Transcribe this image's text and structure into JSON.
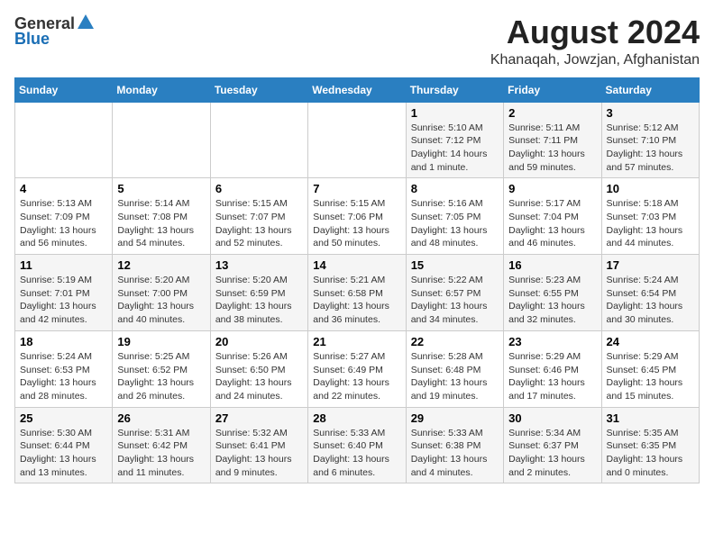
{
  "header": {
    "logo_general": "General",
    "logo_blue": "Blue",
    "title": "August 2024",
    "subtitle": "Khanaqah, Jowzjan, Afghanistan"
  },
  "columns": [
    "Sunday",
    "Monday",
    "Tuesday",
    "Wednesday",
    "Thursday",
    "Friday",
    "Saturday"
  ],
  "weeks": [
    [
      {
        "day": "",
        "info": ""
      },
      {
        "day": "",
        "info": ""
      },
      {
        "day": "",
        "info": ""
      },
      {
        "day": "",
        "info": ""
      },
      {
        "day": "1",
        "info": "Sunrise: 5:10 AM\nSunset: 7:12 PM\nDaylight: 14 hours\nand 1 minute."
      },
      {
        "day": "2",
        "info": "Sunrise: 5:11 AM\nSunset: 7:11 PM\nDaylight: 13 hours\nand 59 minutes."
      },
      {
        "day": "3",
        "info": "Sunrise: 5:12 AM\nSunset: 7:10 PM\nDaylight: 13 hours\nand 57 minutes."
      }
    ],
    [
      {
        "day": "4",
        "info": "Sunrise: 5:13 AM\nSunset: 7:09 PM\nDaylight: 13 hours\nand 56 minutes."
      },
      {
        "day": "5",
        "info": "Sunrise: 5:14 AM\nSunset: 7:08 PM\nDaylight: 13 hours\nand 54 minutes."
      },
      {
        "day": "6",
        "info": "Sunrise: 5:15 AM\nSunset: 7:07 PM\nDaylight: 13 hours\nand 52 minutes."
      },
      {
        "day": "7",
        "info": "Sunrise: 5:15 AM\nSunset: 7:06 PM\nDaylight: 13 hours\nand 50 minutes."
      },
      {
        "day": "8",
        "info": "Sunrise: 5:16 AM\nSunset: 7:05 PM\nDaylight: 13 hours\nand 48 minutes."
      },
      {
        "day": "9",
        "info": "Sunrise: 5:17 AM\nSunset: 7:04 PM\nDaylight: 13 hours\nand 46 minutes."
      },
      {
        "day": "10",
        "info": "Sunrise: 5:18 AM\nSunset: 7:03 PM\nDaylight: 13 hours\nand 44 minutes."
      }
    ],
    [
      {
        "day": "11",
        "info": "Sunrise: 5:19 AM\nSunset: 7:01 PM\nDaylight: 13 hours\nand 42 minutes."
      },
      {
        "day": "12",
        "info": "Sunrise: 5:20 AM\nSunset: 7:00 PM\nDaylight: 13 hours\nand 40 minutes."
      },
      {
        "day": "13",
        "info": "Sunrise: 5:20 AM\nSunset: 6:59 PM\nDaylight: 13 hours\nand 38 minutes."
      },
      {
        "day": "14",
        "info": "Sunrise: 5:21 AM\nSunset: 6:58 PM\nDaylight: 13 hours\nand 36 minutes."
      },
      {
        "day": "15",
        "info": "Sunrise: 5:22 AM\nSunset: 6:57 PM\nDaylight: 13 hours\nand 34 minutes."
      },
      {
        "day": "16",
        "info": "Sunrise: 5:23 AM\nSunset: 6:55 PM\nDaylight: 13 hours\nand 32 minutes."
      },
      {
        "day": "17",
        "info": "Sunrise: 5:24 AM\nSunset: 6:54 PM\nDaylight: 13 hours\nand 30 minutes."
      }
    ],
    [
      {
        "day": "18",
        "info": "Sunrise: 5:24 AM\nSunset: 6:53 PM\nDaylight: 13 hours\nand 28 minutes."
      },
      {
        "day": "19",
        "info": "Sunrise: 5:25 AM\nSunset: 6:52 PM\nDaylight: 13 hours\nand 26 minutes."
      },
      {
        "day": "20",
        "info": "Sunrise: 5:26 AM\nSunset: 6:50 PM\nDaylight: 13 hours\nand 24 minutes."
      },
      {
        "day": "21",
        "info": "Sunrise: 5:27 AM\nSunset: 6:49 PM\nDaylight: 13 hours\nand 22 minutes."
      },
      {
        "day": "22",
        "info": "Sunrise: 5:28 AM\nSunset: 6:48 PM\nDaylight: 13 hours\nand 19 minutes."
      },
      {
        "day": "23",
        "info": "Sunrise: 5:29 AM\nSunset: 6:46 PM\nDaylight: 13 hours\nand 17 minutes."
      },
      {
        "day": "24",
        "info": "Sunrise: 5:29 AM\nSunset: 6:45 PM\nDaylight: 13 hours\nand 15 minutes."
      }
    ],
    [
      {
        "day": "25",
        "info": "Sunrise: 5:30 AM\nSunset: 6:44 PM\nDaylight: 13 hours\nand 13 minutes."
      },
      {
        "day": "26",
        "info": "Sunrise: 5:31 AM\nSunset: 6:42 PM\nDaylight: 13 hours\nand 11 minutes."
      },
      {
        "day": "27",
        "info": "Sunrise: 5:32 AM\nSunset: 6:41 PM\nDaylight: 13 hours\nand 9 minutes."
      },
      {
        "day": "28",
        "info": "Sunrise: 5:33 AM\nSunset: 6:40 PM\nDaylight: 13 hours\nand 6 minutes."
      },
      {
        "day": "29",
        "info": "Sunrise: 5:33 AM\nSunset: 6:38 PM\nDaylight: 13 hours\nand 4 minutes."
      },
      {
        "day": "30",
        "info": "Sunrise: 5:34 AM\nSunset: 6:37 PM\nDaylight: 13 hours\nand 2 minutes."
      },
      {
        "day": "31",
        "info": "Sunrise: 5:35 AM\nSunset: 6:35 PM\nDaylight: 13 hours\nand 0 minutes."
      }
    ]
  ]
}
